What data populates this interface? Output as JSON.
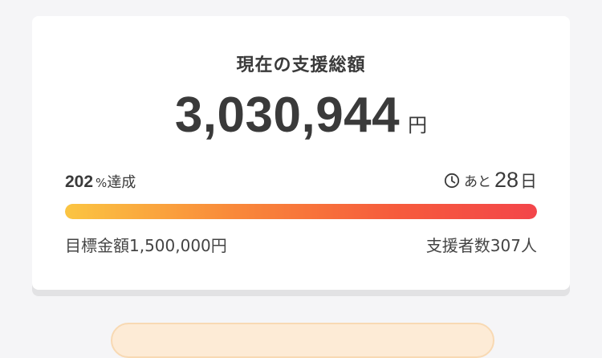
{
  "funding": {
    "title": "現在の支援総額",
    "amount": "3,030,944",
    "currency": "円",
    "achievement_value": "202",
    "achievement_sign": "%",
    "achievement_label": "達成",
    "remaining_prefix": "あと",
    "remaining_days": "28",
    "remaining_unit": "日",
    "progress_fraction": 1.0,
    "goal_text": "目標金額1,500,000円",
    "supporters_text": "支援者数307人"
  },
  "colors": {
    "progress_start": "#fbc542",
    "progress_end": "#f3454a",
    "text": "#3a3a3a",
    "card": "#ffffff",
    "background": "#f5f5f7"
  },
  "icons": {
    "remaining": "clock-icon"
  }
}
